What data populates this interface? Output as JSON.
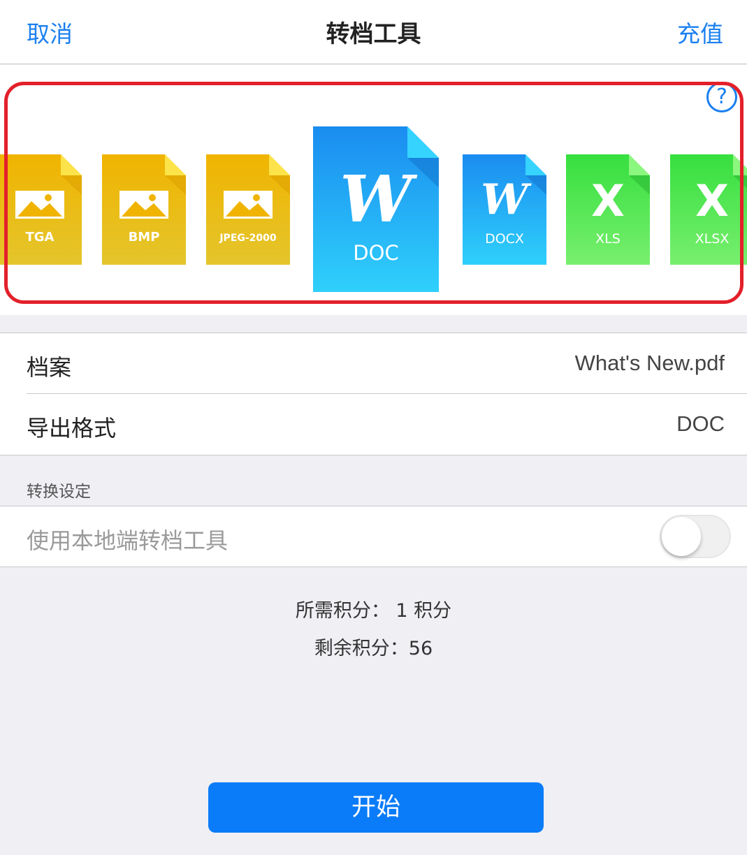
{
  "nav": {
    "cancel": "取消",
    "title": "转档工具",
    "recharge": "充值"
  },
  "help_symbol": "?",
  "formats": [
    {
      "label": "TGA",
      "kind": "image",
      "color": "#f0b600"
    },
    {
      "label": "BMP",
      "kind": "image",
      "color": "#f0b600"
    },
    {
      "label": "JPEG-2000",
      "kind": "image",
      "color": "#f0b600"
    },
    {
      "label": "DOC",
      "kind": "word",
      "color": "#1e95f3",
      "selected": true
    },
    {
      "label": "DOCX",
      "kind": "word",
      "color": "#1e95f3"
    },
    {
      "label": "XLS",
      "kind": "excel",
      "color": "#3ee24a"
    },
    {
      "label": "XLSX",
      "kind": "excel",
      "color": "#3ee24a"
    }
  ],
  "glyphs": {
    "word": "W",
    "excel": "X"
  },
  "file_row": {
    "label": "档案",
    "value": "What's New.pdf"
  },
  "format_row": {
    "label": "导出格式",
    "value": "DOC"
  },
  "settings_section": {
    "label": "转换设定"
  },
  "local_tool": {
    "label": "使用本地端转档工具",
    "enabled": false
  },
  "required_points": "所需积分：  1 积分",
  "remaining_points": "剩余积分：56",
  "start_button": "开始",
  "colors": {
    "accent": "#1a7ff0",
    "highlight": "#e3202a",
    "start": "#0a7cf9"
  }
}
